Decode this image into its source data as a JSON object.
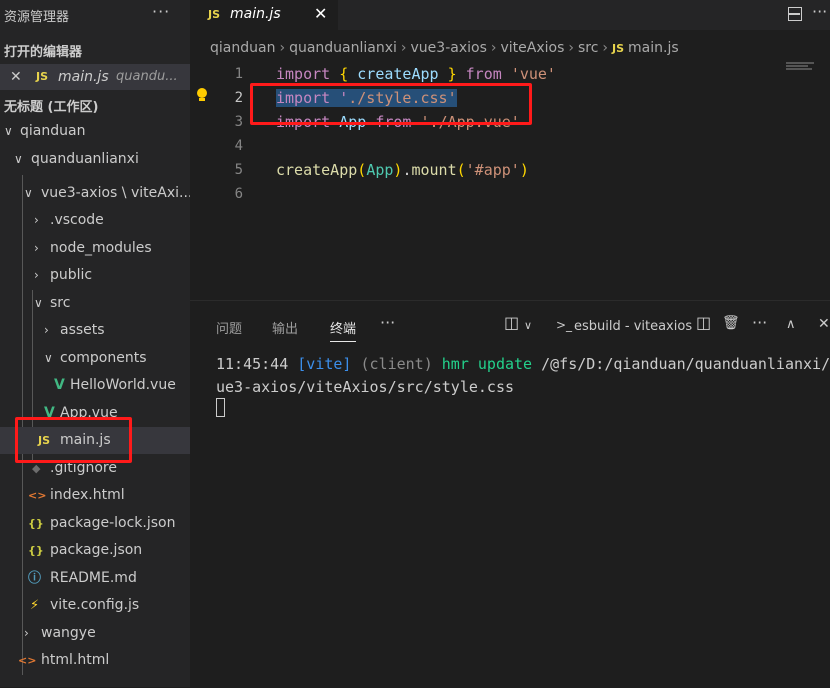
{
  "sidebar": {
    "title": "资源管理器",
    "more": "···",
    "open_editors_title": "打开的编辑器",
    "open_editor": {
      "close": "✕",
      "icon": "JS",
      "name": "main.js",
      "path": "quandu..."
    },
    "workspace_title": "无标题 (工作区)",
    "tree": [
      {
        "label": "qianduan",
        "chev": "∨"
      },
      {
        "label": "quanduanlianxi",
        "chev": "∨"
      },
      {
        "label": "vue3-axios \\ viteAxi...",
        "chev": "∨"
      },
      {
        "label": ".vscode",
        "chev": "›"
      },
      {
        "label": "node_modules",
        "chev": "›"
      },
      {
        "label": "public",
        "chev": "›"
      },
      {
        "label": "src",
        "chev": "∨"
      },
      {
        "label": "assets",
        "chev": "›"
      },
      {
        "label": "components",
        "chev": "∨"
      },
      {
        "label": "HelloWorld.vue",
        "icon": "V"
      },
      {
        "label": "App.vue",
        "icon": "V"
      },
      {
        "label": "main.js",
        "icon": "JS"
      },
      {
        "label": ".gitignore",
        "icon": "◆"
      },
      {
        "label": "index.html",
        "icon": "<>"
      },
      {
        "label": "package-lock.json",
        "icon": "{}"
      },
      {
        "label": "package.json",
        "icon": "{}"
      },
      {
        "label": "README.md",
        "icon": "ⓘ"
      },
      {
        "label": "vite.config.js",
        "icon": "⚡"
      },
      {
        "label": "wangye",
        "chev": "›"
      },
      {
        "label": "html.html",
        "icon": "<>"
      }
    ]
  },
  "tab": {
    "icon": "JS",
    "name": "main.js",
    "close": "✕"
  },
  "breadcrumb": [
    "qianduan",
    "quanduanlianxi",
    "vue3-axios",
    "viteAxios",
    "src",
    "main.js"
  ],
  "breadcrumb_icon": "JS",
  "breadcrumb_sep": "›",
  "editor": {
    "line_numbers": [
      "1",
      "2",
      "3",
      "4",
      "5",
      "6"
    ],
    "lines": [
      [
        {
          "t": "import",
          "c": "kw"
        },
        {
          "t": " "
        },
        {
          "t": "{",
          "c": "br"
        },
        {
          "t": " "
        },
        {
          "t": "createApp",
          "c": "vr"
        },
        {
          "t": " "
        },
        {
          "t": "}",
          "c": "br"
        },
        {
          "t": " "
        },
        {
          "t": "from",
          "c": "kw"
        },
        {
          "t": " "
        },
        {
          "t": "'vue'",
          "c": "str"
        }
      ],
      [
        {
          "t": "import '",
          "c": "kw hl"
        },
        {
          "t": "./style.css'",
          "c": "str hl"
        }
      ],
      [
        {
          "t": "import",
          "c": "kw"
        },
        {
          "t": " "
        },
        {
          "t": "App",
          "c": "vr"
        },
        {
          "t": " "
        },
        {
          "t": "from",
          "c": "kw"
        },
        {
          "t": " "
        },
        {
          "t": "'./App.vue'",
          "c": "str"
        }
      ],
      [],
      [
        {
          "t": "createApp",
          "c": "fn"
        },
        {
          "t": "(",
          "c": "br"
        },
        {
          "t": "App",
          "c": "cls"
        },
        {
          "t": ")",
          "c": "br"
        },
        {
          "t": "."
        },
        {
          "t": "mount",
          "c": "fn"
        },
        {
          "t": "(",
          "c": "br"
        },
        {
          "t": "'#app'",
          "c": "str"
        },
        {
          "t": ")",
          "c": "br"
        }
      ],
      []
    ]
  },
  "panel": {
    "tabs": [
      "问题",
      "输出",
      "终端"
    ],
    "more": "···",
    "terminal_name": "esbuild - viteaxios",
    "tools": {
      "split": "◫",
      "dropdown": "∨",
      "split2": "◫",
      "trash": "🗑",
      "more": "···",
      "maximize": "∧",
      "close": "✕"
    },
    "line1": {
      "time": "11:45:44 ",
      "tag": "[vite]",
      "client": " (client) ",
      "hmr": "hmr update",
      "path": " /@fs/D:/qianduan/quanduanlianxi/v"
    },
    "line2": "ue3-axios/viteAxios/src/style.css"
  },
  "colors": {
    "highlight_box": "#ff1a1a",
    "js_icon": "#e8d44d",
    "vue_icon": "#41b883"
  }
}
